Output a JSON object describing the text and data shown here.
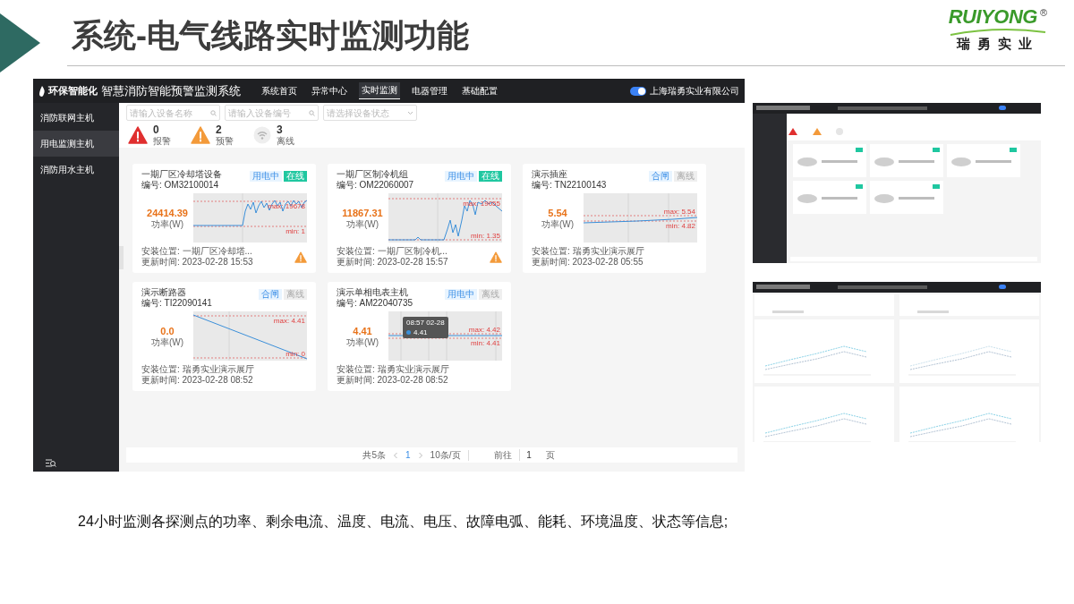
{
  "slide": {
    "title": "系统-电气线路实时监测功能",
    "logo": {
      "brand": "RUIYONG",
      "mark": "®",
      "subtitle": "瑞勇实业"
    },
    "caption": "24小时监测各探测点的功率、剩余电流、温度、电流、电压、故障电弧、能耗、环境温度、状态等信息;"
  },
  "app": {
    "brand": "环保智能化",
    "system_title": "智慧消防智能预警监测系统",
    "nav": [
      {
        "label": "系统首页",
        "selected": false
      },
      {
        "label": "异常中心",
        "selected": false
      },
      {
        "label": "实时监测",
        "selected": true
      },
      {
        "label": "电器管理",
        "selected": false
      },
      {
        "label": "基础配置",
        "selected": false
      }
    ],
    "toggle": {
      "on": true
    },
    "company": "上海瑞勇实业有限公司",
    "sidebar": {
      "items": [
        {
          "label": "消防联网主机",
          "selected": false
        },
        {
          "label": "用电监测主机",
          "selected": true
        },
        {
          "label": "消防用水主机",
          "selected": false
        }
      ]
    },
    "filters": [
      {
        "placeholder": "请输入设备名称",
        "kind": "search"
      },
      {
        "placeholder": "请输入设备编号",
        "kind": "search"
      },
      {
        "placeholder": "请选择设备状态",
        "kind": "select"
      }
    ],
    "stats": [
      {
        "kind": "alarm",
        "count": "0",
        "label": "报警"
      },
      {
        "kind": "warning",
        "count": "2",
        "label": "预警"
      },
      {
        "kind": "offline",
        "count": "3",
        "label": "离线"
      }
    ],
    "cards": [
      {
        "title": "一期厂区冷却塔设备",
        "code": "编号: OM32100014",
        "value": "24414.39",
        "unit": "功率(W)",
        "tags": [
          {
            "label": "用电中",
            "kind": "info"
          },
          {
            "label": "在线",
            "kind": "online"
          }
        ],
        "max_label": "max: 19678",
        "min_label": "min: 1",
        "location": "安装位置: 一期厂区冷却塔...",
        "updated": "更新时间: 2023-02-28 15:53",
        "warning": true
      },
      {
        "title": "一期厂区制冷机组",
        "code": "编号: OM22060007",
        "value": "11867.31",
        "unit": "功率(W)",
        "tags": [
          {
            "label": "用电中",
            "kind": "info"
          },
          {
            "label": "在线",
            "kind": "online"
          }
        ],
        "max_label": "max: 19055",
        "min_label": "min: 1.35",
        "location": "安装位置: 一期厂区制冷机...",
        "updated": "更新时间: 2023-02-28 15:57",
        "warning": true
      },
      {
        "title": "演示插座",
        "code": "编号: TN22100143",
        "value": "5.54",
        "unit": "功率(W)",
        "tags": [
          {
            "label": "合闸",
            "kind": "info"
          },
          {
            "label": "离线",
            "kind": "offline"
          }
        ],
        "max_label": "max: 5.54",
        "min_label": "min: 4.82",
        "location": "安装位置: 瑞勇实业演示展厅",
        "updated": "更新时间: 2023-02-28 05:55",
        "warning": false
      },
      {
        "title": "演示断路器",
        "code": "编号: TI22090141",
        "value": "0.0",
        "unit": "功率(W)",
        "tags": [
          {
            "label": "合闸",
            "kind": "info"
          },
          {
            "label": "离线",
            "kind": "offline"
          }
        ],
        "max_label": "max: 4.41",
        "min_label": "min: 0",
        "location": "安装位置: 瑞勇实业演示展厅",
        "updated": "更新时间: 2023-02-28 08:52",
        "warning": false
      },
      {
        "title": "演示单相电表主机",
        "code": "编号: AM22040735",
        "value": "4.41",
        "unit": "功率(W)",
        "tags": [
          {
            "label": "用电中",
            "kind": "info"
          },
          {
            "label": "离线",
            "kind": "offline"
          }
        ],
        "max_label": "max: 4.42",
        "min_label": "min: 4.41",
        "location": "安装位置: 瑞勇实业演示展厅",
        "updated": "更新时间: 2023-02-28 08:52",
        "warning": false,
        "tooltip": {
          "time": "08:57 02-28",
          "value": "4.41"
        }
      }
    ],
    "pagination": {
      "total": "共5条",
      "page": "1",
      "page_size": "10条/页",
      "goto_label": "前往",
      "goto_value": "1",
      "page_suffix": "页"
    }
  }
}
